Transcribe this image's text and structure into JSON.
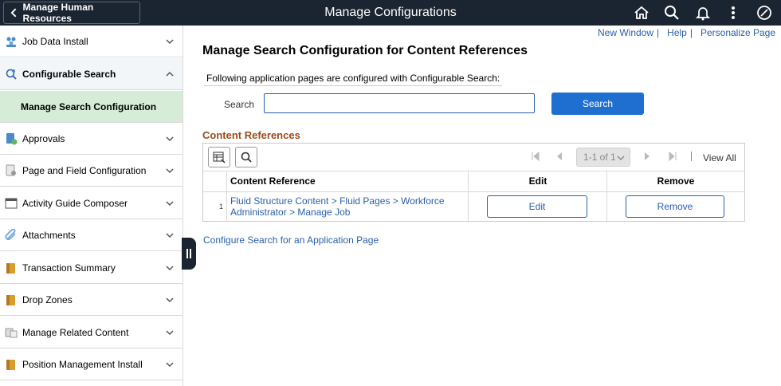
{
  "header": {
    "back_label": "Manage Human Resources",
    "title": "Manage Configurations",
    "icons": [
      "home-icon",
      "search-icon",
      "bell-icon",
      "more-vertical-icon",
      "navbar-compass-icon"
    ]
  },
  "sidebar": {
    "items": [
      {
        "label": "Job Data Install",
        "icon": "people-icon"
      },
      {
        "label": "Configurable Search",
        "icon": "search-gear-icon"
      },
      {
        "label": "Approvals",
        "icon": "approvals-icon"
      },
      {
        "label": "Page and Field Configuration",
        "icon": "page-config-icon"
      },
      {
        "label": "Activity Guide Composer",
        "icon": "activity-guide-icon"
      },
      {
        "label": "Attachments",
        "icon": "paperclip-icon"
      },
      {
        "label": "Transaction Summary",
        "icon": "folder-icon"
      },
      {
        "label": "Drop Zones",
        "icon": "folder-icon"
      },
      {
        "label": "Manage Related Content",
        "icon": "related-content-icon"
      },
      {
        "label": "Position Management Install",
        "icon": "folder-icon"
      }
    ],
    "sub_item": "Manage Search Configuration"
  },
  "links": {
    "new_window": "New Window",
    "help": "Help",
    "personalize": "Personalize Page",
    "separator": "|"
  },
  "main": {
    "title": "Manage Search Configuration for Content References",
    "instructions": "Following application pages are configured with Configurable Search:",
    "search_label": "Search",
    "search_value": "",
    "search_button": "Search",
    "section_title": "Content References",
    "pagination": "1-1 of 1",
    "view_all": "View All",
    "columns": [
      "Content Reference",
      "Edit",
      "Remove"
    ],
    "rows": [
      {
        "num": "1",
        "content_reference": "Fluid Structure Content > Fluid Pages > Workforce Administrator > Manage Job",
        "edit": "Edit",
        "remove": "Remove"
      }
    ],
    "configure_link": "Configure Search for an Application Page"
  },
  "colors": {
    "header_bg": "#1b2431",
    "link": "#2a5fa8",
    "primary_button": "#1f6fd0",
    "selected_sub_item": "#d6ecd7",
    "section_title": "#9b4b1a"
  }
}
